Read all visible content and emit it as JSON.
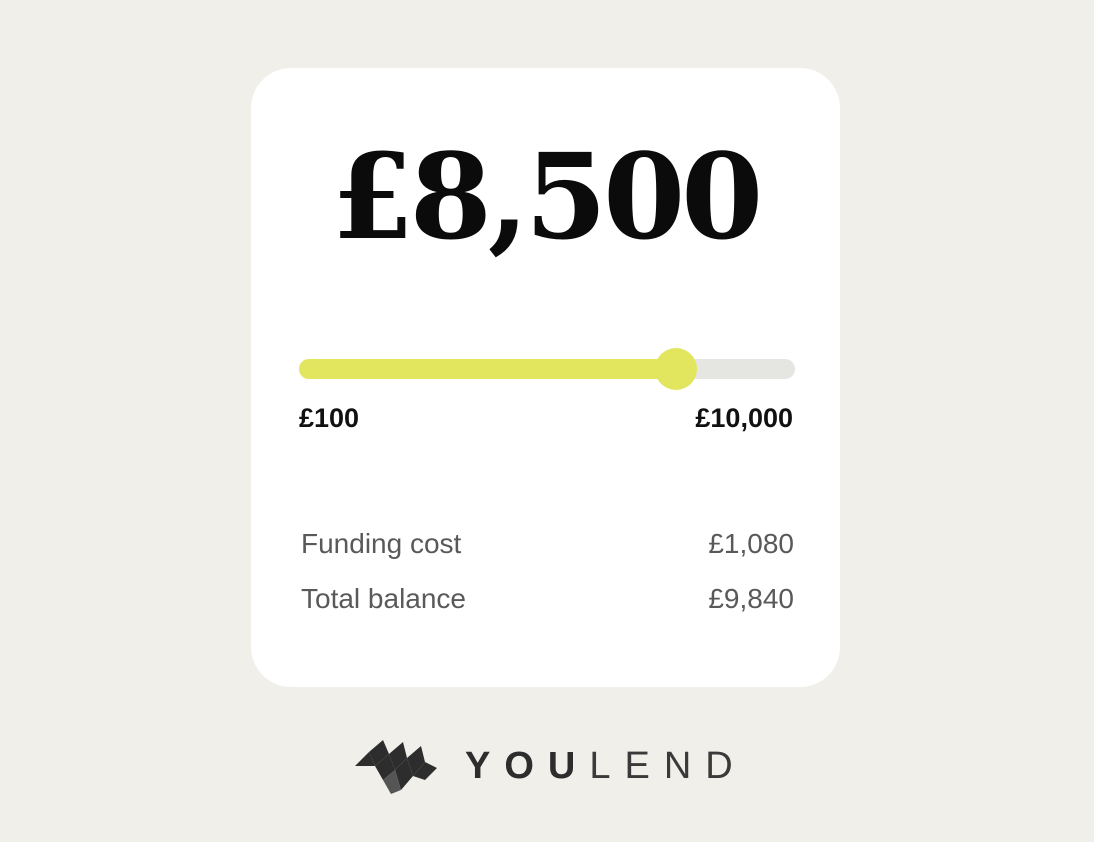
{
  "calculator": {
    "amount": "£8,500",
    "slider": {
      "value_fraction": 0.76,
      "min_label": "£100",
      "max_label": "£10,000"
    },
    "rows": [
      {
        "label": "Funding cost",
        "value": "£1,080"
      },
      {
        "label": "Total balance",
        "value": "£9,840"
      }
    ]
  },
  "brand": {
    "name_bold": "YOU",
    "name_light": "LEND",
    "icon": "youlend-logo-mark"
  },
  "colors": {
    "background": "#f0efea",
    "card": "#ffffff",
    "accent": "#e2e65f",
    "track": "#e5e5e2"
  }
}
